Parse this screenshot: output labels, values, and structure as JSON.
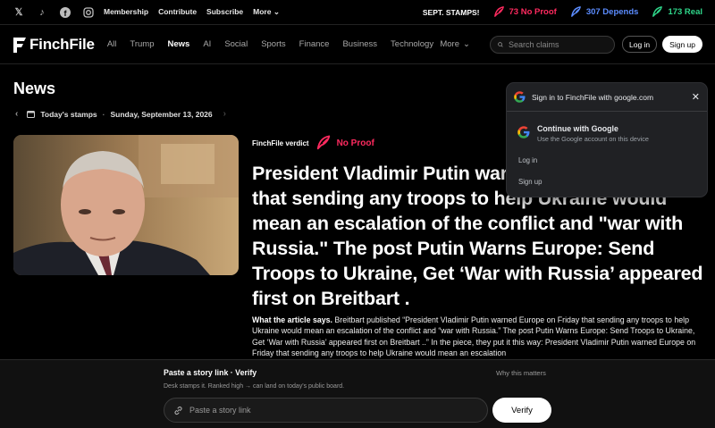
{
  "topbar": {
    "social_icons": [
      "x-icon",
      "tiktok-icon",
      "facebook-icon",
      "instagram-icon"
    ],
    "links": [
      "Membership",
      "Contribute",
      "Subscribe",
      "More"
    ],
    "stamps_label": "SEPT. STAMPS!",
    "stamps": [
      {
        "text": "73 No Proof",
        "color": "#ff2a5f"
      },
      {
        "text": "307 Depends",
        "color": "#5b8cff"
      },
      {
        "text": "173 Real",
        "color": "#2fd68a"
      }
    ]
  },
  "nav": {
    "brand": "FinchFile",
    "links": [
      "All",
      "Trump",
      "News",
      "AI",
      "Social",
      "Sports",
      "Finance",
      "Business",
      "Technology"
    ],
    "active": "News",
    "more": "More",
    "search_placeholder": "Search claims",
    "login": "Log in",
    "signup": "Sign up"
  },
  "page": {
    "title": "News",
    "stamps_label": "Today's stamps",
    "date": "Sunday, September 13, 2026"
  },
  "article": {
    "verdict_label": "FinchFile verdict",
    "verdict": "No Proof",
    "verdict_color": "#ff2a5f",
    "headline": "President Vladimir Putin warned Europe on Friday that sending any troops to help Ukraine would mean an escalation of the conflict and \"war with Russia.\" The post Putin Warns Europe: Send Troops to Ukraine, Get ‘War with Russia’ appeared first on Breitbart .",
    "body_lead": "What the article says.",
    "body": "Breitbart published “President Vladimir Putin warned Europe on Friday that sending any troops to help Ukraine would mean an escalation of the conflict and “war with Russia.” The post Putin Warns Europe: Send Troops to Ukraine, Get ‘War with Russia’ appeared first on Breitbart ..” In the piece, they put it this way: President Vladimir Putin warned Europe on Friday that sending any troops to help Ukraine would mean an escalation"
  },
  "verify": {
    "title": "Paste a story link · Verify",
    "why": "Why this matters",
    "subtitle": "Desk stamps it. Ranked high → can land on today's public board.",
    "placeholder": "Paste a story link",
    "button": "Verify"
  },
  "google_popup": {
    "title": "Sign in to FinchFile with google.com",
    "continue_title": "Continue with Google",
    "continue_sub": "Use the Google account on this device",
    "login": "Log in",
    "signup": "Sign up"
  }
}
